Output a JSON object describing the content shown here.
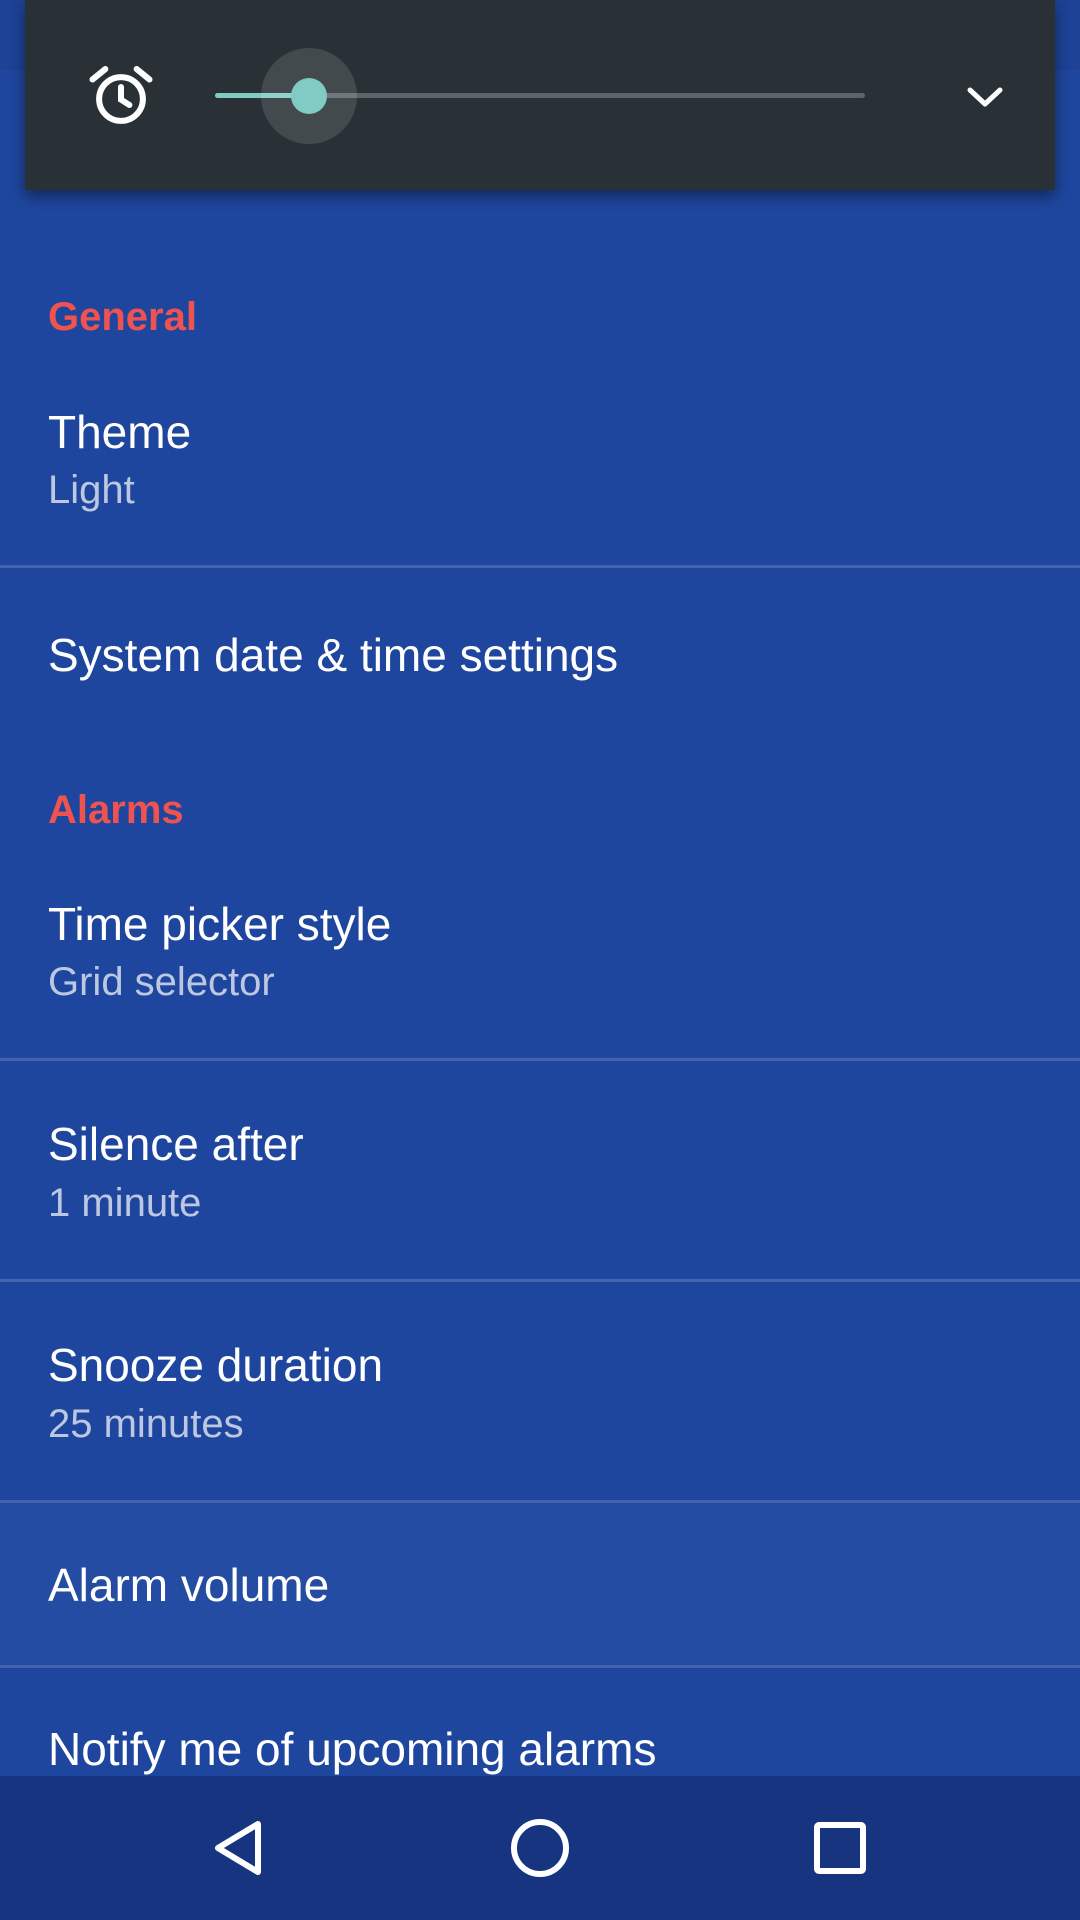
{
  "volume_popup": {
    "icon": "alarm-clock-icon",
    "slider_level": 0.145,
    "expand_icon": "chevron-down-icon",
    "accent_color": "#80cbc4"
  },
  "sections": {
    "general": {
      "header": "General",
      "theme": {
        "title": "Theme",
        "summary": "Light"
      },
      "system_datetime": {
        "title": "System date & time settings"
      }
    },
    "alarms": {
      "header": "Alarms",
      "time_picker": {
        "title": "Time picker style",
        "summary": "Grid selector"
      },
      "silence_after": {
        "title": "Silence after",
        "summary": "1 minute"
      },
      "snooze_duration": {
        "title": "Snooze duration",
        "summary": "25 minutes"
      },
      "alarm_volume": {
        "title": "Alarm volume"
      },
      "notify_upcoming": {
        "title": "Notify me of upcoming alarms"
      }
    }
  },
  "colors": {
    "background": "#1f469e",
    "section_header": "#ef5350",
    "popup_background": "#293136",
    "nav_bar": "#163480"
  },
  "nav_bar": {
    "back_icon": "back-triangle-icon",
    "home_icon": "home-circle-icon",
    "recents_icon": "recents-square-icon"
  }
}
